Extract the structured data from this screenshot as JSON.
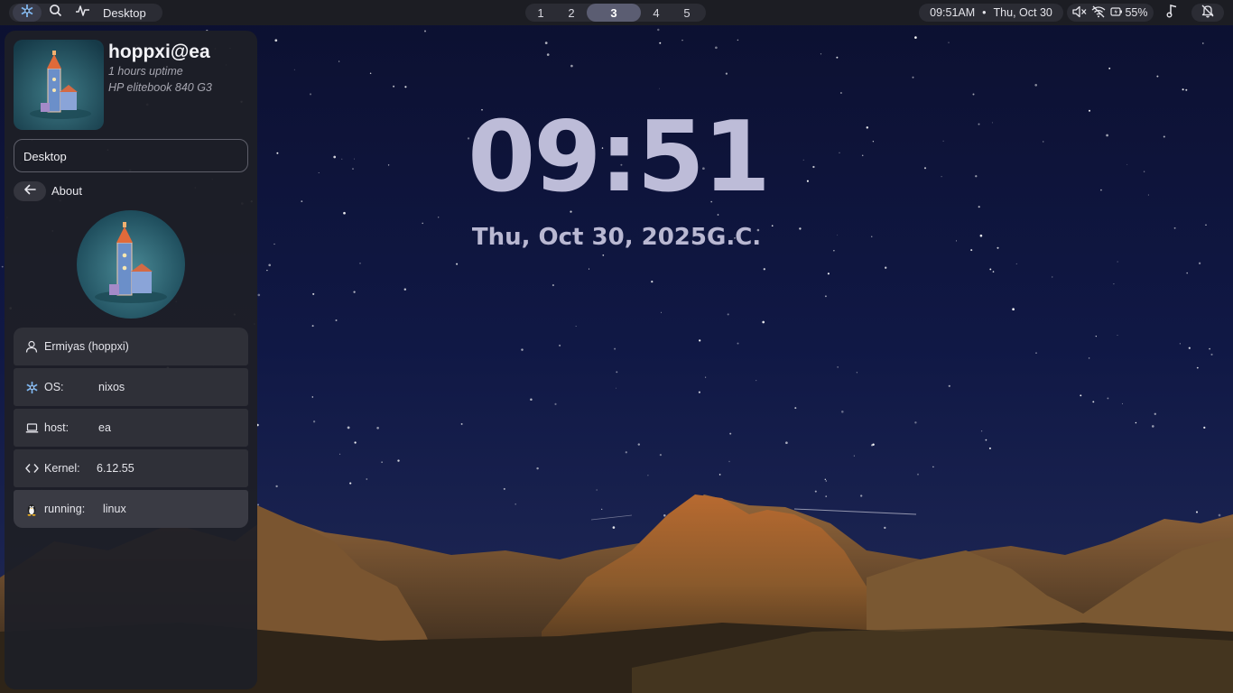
{
  "topbar": {
    "nix_icon": "nixos-snowflake-icon",
    "search_icon": "search-icon",
    "activity_icon": "activity-pulse-icon",
    "window_title": "Desktop",
    "workspaces": [
      "1",
      "2",
      "3",
      "4",
      "5"
    ],
    "active_workspace": "3",
    "time": "09:51AM",
    "separator": "•",
    "date": "Thu, Oct 30",
    "status": {
      "volume_icon": "volume-muted-icon",
      "wifi_icon": "wifi-off-icon",
      "battery_icon": "battery-charging-icon",
      "battery_percent": "55%"
    },
    "music_icon": "music-note-icon",
    "bell_icon": "notifications-off-icon"
  },
  "panel": {
    "username": "hoppxi@ea",
    "uptime": "1 hours uptime",
    "machine": "HP elitebook 840 G3",
    "window_field": "Desktop",
    "back_icon": "arrow-left-icon",
    "section_title": "About",
    "rows": [
      {
        "icon": "user-icon",
        "label": "",
        "value": "Ermiyas (hoppxi)"
      },
      {
        "icon": "nixos-snowflake-icon",
        "label": "OS:",
        "value": "nixos"
      },
      {
        "icon": "laptop-icon",
        "label": "host:",
        "value": "ea"
      },
      {
        "icon": "code-icon",
        "label": "Kernel:",
        "value": "6.12.55"
      },
      {
        "icon": "tux-penguin-icon",
        "label": "running:",
        "value": "linux"
      }
    ]
  },
  "desktop": {
    "clock": "09:51",
    "date": "Thu, Oct 30, 2025G.C."
  },
  "colors": {
    "bar_bg": "#1c1d23",
    "pill_bg": "#2b2c34",
    "active_ws": "#5b5d72",
    "panel_bg": "#1e1f26",
    "clock_text": "#bdbcd8",
    "nix_blue": "#7eb6f0"
  }
}
